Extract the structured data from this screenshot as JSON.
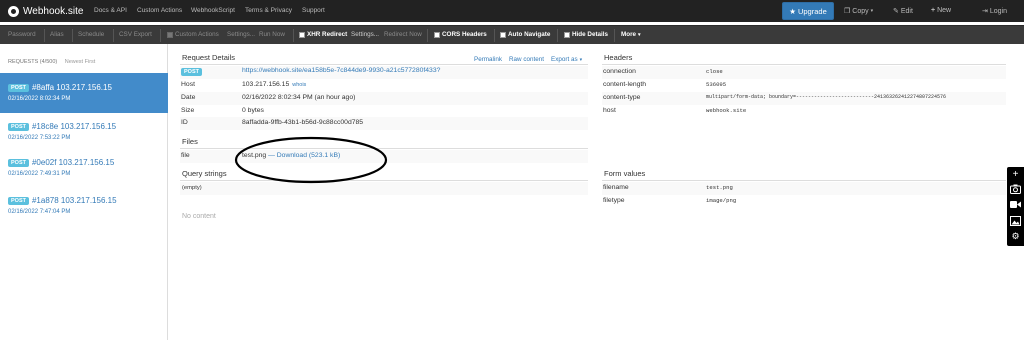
{
  "nav": {
    "brand": "Webhook.site",
    "links": [
      "Docs & API",
      "Custom Actions",
      "WebhookScript",
      "Terms & Privacy",
      "Support"
    ],
    "upgrade_label": "Upgrade",
    "copy_label": "Copy",
    "edit_label": "Edit",
    "new_label": "New",
    "login_label": "Login"
  },
  "toolbar": {
    "password": "Password",
    "alias": "Alias",
    "schedule": "Schedule",
    "csv_export": "CSV Export",
    "custom_actions": "Custom Actions",
    "settings1": "Settings...",
    "run_now": "Run Now",
    "xhr_redirect": "XHR Redirect",
    "settings2": "Settings...",
    "redirect_now": "Redirect Now",
    "cors_headers": "CORS Headers",
    "auto_navigate": "Auto Navigate",
    "hide_details": "Hide Details",
    "more": "More"
  },
  "sidebar": {
    "heading": "REQUESTS (4/500)",
    "sort": "Newest First",
    "requests": [
      {
        "method": "POST",
        "id_ip": "#8affa 103.217.156.15",
        "time": "02/16/2022 8:02:34 PM"
      },
      {
        "method": "POST",
        "id_ip": "#18c8e 103.217.156.15",
        "time": "02/16/2022 7:53:22 PM"
      },
      {
        "method": "POST",
        "id_ip": "#0e02f 103.217.156.15",
        "time": "02/16/2022 7:49:31 PM"
      },
      {
        "method": "POST",
        "id_ip": "#1a878 103.217.156.15",
        "time": "02/16/2022 7:47:04 PM"
      }
    ]
  },
  "details": {
    "title": "Request Details",
    "permalink": "Permalink",
    "raw_content": "Raw content",
    "export_as": "Export as",
    "method": "POST",
    "url": "https://webhook.site/ea158b5e-7c844de9-9930-a21c577280f433?",
    "host_label": "Host",
    "host_value": "103.217.156.15",
    "whois": "whois",
    "date_label": "Date",
    "date_value": "02/16/2022 8:02:34 PM (an hour ago)",
    "size_label": "Size",
    "size_value": "0 bytes",
    "id_label": "ID",
    "id_value": "8affadda-9ffb-43b1-b56d-9c88cc00d785"
  },
  "files": {
    "title": "Files",
    "key": "file",
    "filename": "test.png",
    "download": "— Download (523.1 kB)"
  },
  "query": {
    "title": "Query strings",
    "empty": "(empty)"
  },
  "no_content": "No content",
  "headers": {
    "title": "Headers",
    "rows": [
      {
        "key": "connection",
        "value": "close"
      },
      {
        "key": "content-length",
        "value": "536095"
      },
      {
        "key": "content-type",
        "value": "multipart/form-data; boundary=--------------------------241363262412274807224576"
      },
      {
        "key": "host",
        "value": "webhook.site"
      }
    ]
  },
  "form_values": {
    "title": "Form values",
    "rows": [
      {
        "key": "filename",
        "value": "test.png"
      },
      {
        "key": "filetype",
        "value": "image/png"
      }
    ]
  },
  "colors": {
    "navbar": "#222222",
    "toolbar": "#3a3a3a",
    "accent": "#337ab7",
    "active_item": "#428bca",
    "badge": "#5bc0de"
  },
  "icons": [
    "webhook-logo-icon",
    "star-icon",
    "copy-icon",
    "edit-icon",
    "plus-icon",
    "login-icon",
    "camera-icon",
    "video-icon",
    "image-icon",
    "gear-icon"
  ]
}
